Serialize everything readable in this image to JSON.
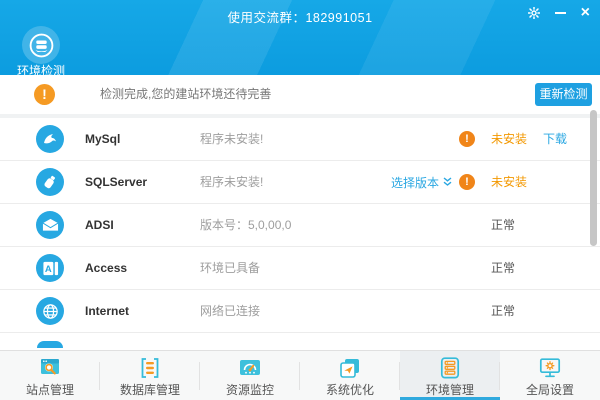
{
  "titlebar": {
    "title": "使用交流群：182991051",
    "close_glyph": "×"
  },
  "header": {
    "module_label": "环境检测"
  },
  "glyphs": {
    "exclamation": "!"
  },
  "notice": {
    "message": "检测完成,您的建站环境还待完善",
    "recheck_button": "重新检测"
  },
  "checks": [
    {
      "name": "MySql",
      "icon": "mysql-dolphin-icon",
      "status_text": "程序未安装!",
      "state": "未安装",
      "state_type": "warning",
      "download_label": "下载"
    },
    {
      "name": "SQLServer",
      "icon": "sqlserver-flask-icon",
      "status_text": "程序未安装!",
      "state": "未安装",
      "state_type": "warning",
      "version_label": "选择版本"
    },
    {
      "name": "ADSI",
      "icon": "adsi-envelope-icon",
      "status_text": "版本号：5,0,00,0",
      "state": "正常",
      "state_type": "ok"
    },
    {
      "name": "Access",
      "icon": "access-letter-icon",
      "status_text": "环境已具备",
      "state": "正常",
      "state_type": "ok"
    },
    {
      "name": "Internet",
      "icon": "globe-icon",
      "status_text": "网络已连接",
      "state": "正常",
      "state_type": "ok"
    }
  ],
  "nav": {
    "items": [
      {
        "label": "站点管理",
        "selected": false
      },
      {
        "label": "数据库管理",
        "selected": false
      },
      {
        "label": "资源监控",
        "selected": false
      },
      {
        "label": "系统优化",
        "selected": false
      },
      {
        "label": "环境管理",
        "selected": true
      },
      {
        "label": "全局设置",
        "selected": false
      }
    ]
  },
  "colors": {
    "header_blue": "#0fa3e3",
    "badge_blue": "#41b4e8",
    "row_icon_blue": "#27a8e2",
    "accent_blue": "#2aa7e2",
    "warning_orange": "#f59a23",
    "state_warning_text": "#f39800",
    "nav_teal": "#35bbd9",
    "nav_selected_underline": "#2fa9de"
  }
}
